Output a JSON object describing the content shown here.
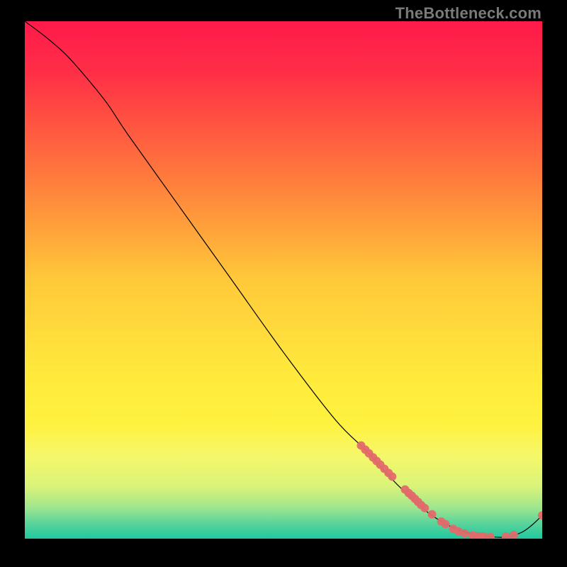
{
  "watermark": "TheBottleneck.com",
  "chart_data": {
    "type": "line",
    "title": "",
    "xlabel": "",
    "ylabel": "",
    "xlim": [
      0,
      100
    ],
    "ylim": [
      0,
      100
    ],
    "grid": false,
    "legend": false,
    "gradient_stops": [
      {
        "pos": 0.0,
        "color": "#ff1a4b"
      },
      {
        "pos": 0.1,
        "color": "#ff2f46"
      },
      {
        "pos": 0.3,
        "color": "#ff7a3c"
      },
      {
        "pos": 0.5,
        "color": "#ffc93a"
      },
      {
        "pos": 0.68,
        "color": "#ffe93c"
      },
      {
        "pos": 0.78,
        "color": "#fff23f"
      },
      {
        "pos": 0.84,
        "color": "#f6f76a"
      },
      {
        "pos": 0.9,
        "color": "#d8f379"
      },
      {
        "pos": 0.94,
        "color": "#9fe68e"
      },
      {
        "pos": 0.97,
        "color": "#5bd49b"
      },
      {
        "pos": 1.0,
        "color": "#1fc8a0"
      }
    ],
    "series": [
      {
        "name": "curve",
        "x": [
          0,
          4,
          8,
          12,
          16,
          20,
          30,
          40,
          50,
          60,
          66,
          70,
          74,
          78,
          82,
          86,
          90,
          93,
          96,
          98,
          100
        ],
        "y": [
          100,
          97,
          93.5,
          89,
          84,
          78,
          64,
          50,
          36,
          23,
          17,
          12.5,
          8.5,
          5,
          2.5,
          1,
          0.4,
          0.3,
          1.2,
          2.6,
          4.5
        ]
      }
    ],
    "markers": [
      {
        "x": 65.0,
        "y": 18.0
      },
      {
        "x": 65.8,
        "y": 17.2
      },
      {
        "x": 66.5,
        "y": 16.5
      },
      {
        "x": 67.3,
        "y": 15.7
      },
      {
        "x": 68.0,
        "y": 15.0
      },
      {
        "x": 68.7,
        "y": 14.3
      },
      {
        "x": 69.5,
        "y": 13.5
      },
      {
        "x": 70.3,
        "y": 12.7
      },
      {
        "x": 71.0,
        "y": 12.0
      },
      {
        "x": 73.5,
        "y": 9.5
      },
      {
        "x": 74.2,
        "y": 8.8
      },
      {
        "x": 74.8,
        "y": 8.3
      },
      {
        "x": 75.4,
        "y": 7.7
      },
      {
        "x": 76.0,
        "y": 7.1
      },
      {
        "x": 76.6,
        "y": 6.5
      },
      {
        "x": 77.3,
        "y": 5.9
      },
      {
        "x": 78.7,
        "y": 4.7
      },
      {
        "x": 80.5,
        "y": 3.3
      },
      {
        "x": 81.3,
        "y": 2.8
      },
      {
        "x": 82.8,
        "y": 1.9
      },
      {
        "x": 83.8,
        "y": 1.4
      },
      {
        "x": 85.0,
        "y": 1.0
      },
      {
        "x": 86.5,
        "y": 0.6
      },
      {
        "x": 87.2,
        "y": 0.5
      },
      {
        "x": 88.0,
        "y": 0.4
      },
      {
        "x": 88.7,
        "y": 0.4
      },
      {
        "x": 90.0,
        "y": 0.3
      },
      {
        "x": 93.0,
        "y": 0.4
      },
      {
        "x": 94.5,
        "y": 0.7
      },
      {
        "x": 100.0,
        "y": 4.5
      }
    ],
    "marker_style": {
      "r": 6,
      "fill": "#e16a6a",
      "opacity": 0.95
    }
  }
}
